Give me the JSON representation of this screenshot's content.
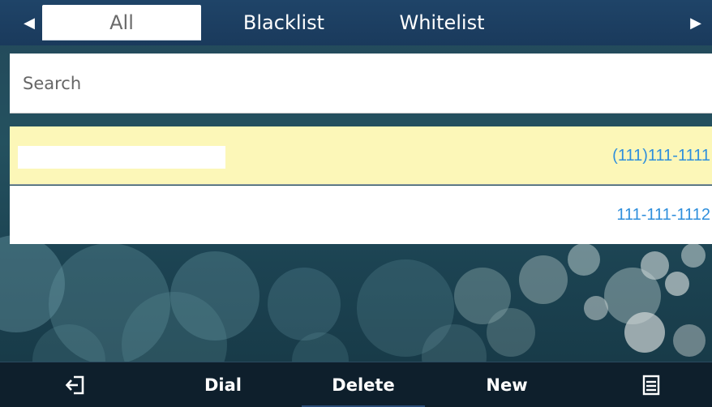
{
  "tabs": {
    "items": [
      {
        "label": "All",
        "active": true
      },
      {
        "label": "Blacklist",
        "active": false
      },
      {
        "label": "Whitelist",
        "active": false
      }
    ],
    "prev_icon": "triangle-left-icon",
    "next_icon": "triangle-right-icon"
  },
  "search": {
    "placeholder": "Search",
    "value": ""
  },
  "contacts": [
    {
      "name": "",
      "number": "(111)111-1111",
      "selected": true
    },
    {
      "name": "",
      "number": "111-111-1112",
      "selected": false
    }
  ],
  "softkeys": {
    "back_icon": "exit-arrow-icon",
    "dial": "Dial",
    "delete": "Delete",
    "new": "New",
    "menu_icon": "menu-list-icon"
  },
  "colors": {
    "tabbar": "#1a3a5c",
    "selected_row": "#fcf7b8",
    "number_text": "#2f8fdc",
    "softbar": "#0e1f2c"
  }
}
